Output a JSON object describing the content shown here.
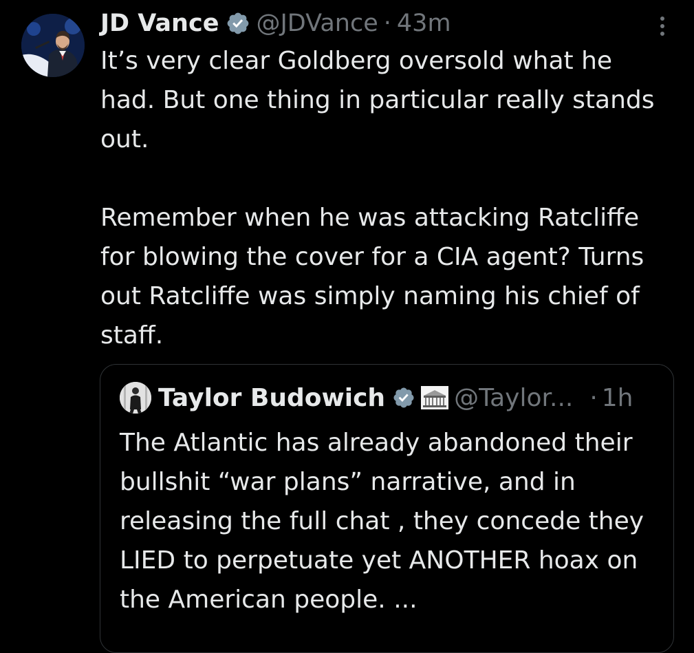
{
  "tweet": {
    "author_name": "JD Vance",
    "handle": "@JDVance",
    "separator": "·",
    "timestamp": "43m",
    "paragraphs": [
      "It’s very clear Goldberg oversold what he had. But one thing in particular really stands out.",
      "Remember when he was attacking Ratcliffe for blowing the cover for a CIA agent? Turns out Ratcliffe was simply naming his chief of staff."
    ],
    "more_icon": "more-vertical-icon",
    "verified_icon": "verified-badge-icon",
    "colors": {
      "background": "#000000",
      "text": "#e7e9ea",
      "secondary": "#71767b",
      "border": "#2f3336",
      "verified": "#829aab"
    }
  },
  "quoted_tweet": {
    "author_name": "Taylor Budowich",
    "handle": "@Taylor...",
    "separator": "·",
    "timestamp": "1h",
    "text": "The Atlantic has already abandoned their bullshit “war plans” narrative, and in releasing the full chat , they concede they LIED to perpetuate yet ANOTHER hoax on the American people. ...",
    "affiliation_icon": "white-house-icon"
  }
}
